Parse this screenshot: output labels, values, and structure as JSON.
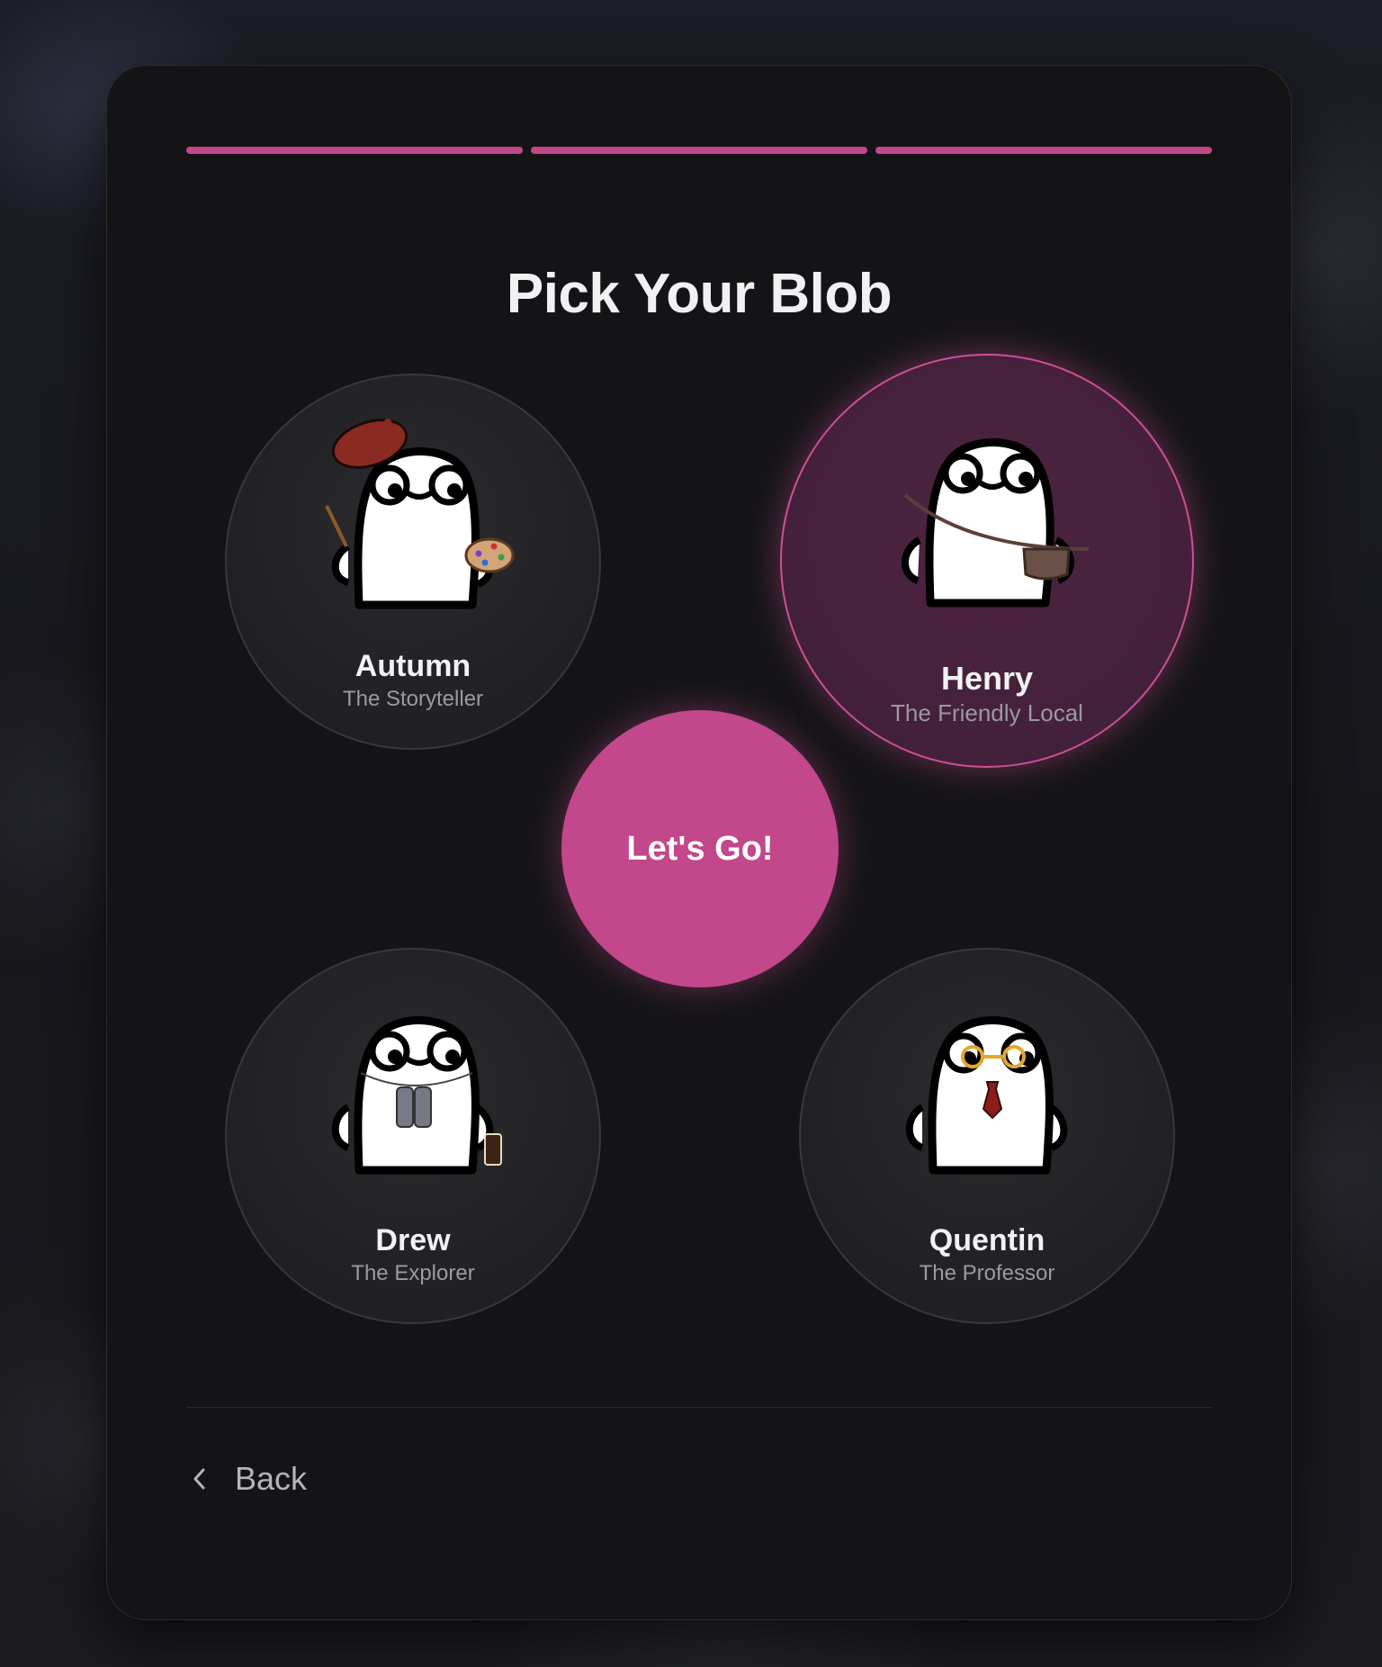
{
  "accent_color": "#c2488a",
  "progress": {
    "steps_total": 3,
    "steps_completed": 3
  },
  "title": "Pick Your Blob",
  "blobs": [
    {
      "name": "Autumn",
      "role": "The Storyteller",
      "icon": "artist-blob-icon",
      "selected": false
    },
    {
      "name": "Henry",
      "role": "The Friendly Local",
      "icon": "satchel-blob-icon",
      "selected": true
    },
    {
      "name": "Drew",
      "role": "The Explorer",
      "icon": "binoculars-blob-icon",
      "selected": false
    },
    {
      "name": "Quentin",
      "role": "The Professor",
      "icon": "glasses-tie-blob-icon",
      "selected": false
    }
  ],
  "go_button": {
    "label": "Let's Go!"
  },
  "back_button": {
    "label": "Back",
    "icon": "chevron-left-icon"
  }
}
